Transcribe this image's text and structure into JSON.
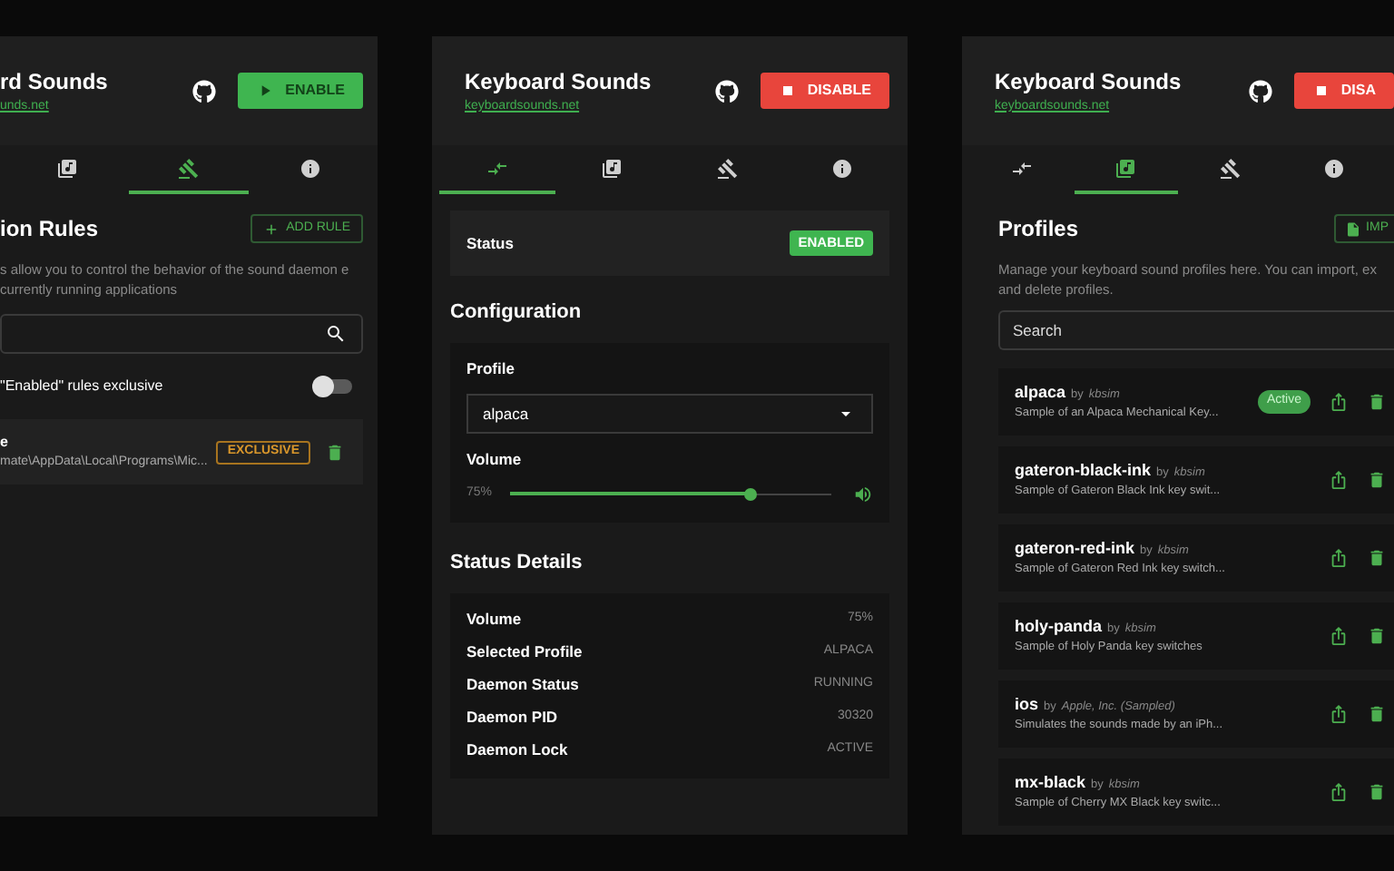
{
  "rules_panel": {
    "title": "rd Sounds",
    "link": "unds.net",
    "button": {
      "kind": "enable",
      "label": "ENABLE"
    },
    "tabs": [
      {
        "kind": "profiles",
        "selected": false
      },
      {
        "kind": "rules",
        "selected": true
      },
      {
        "kind": "about",
        "selected": false
      }
    ],
    "heading": "ion Rules",
    "add_button": "ADD RULE",
    "description": "s allow you to control the behavior of the sound daemon e currently running applications",
    "toggle": {
      "label": "\"Enabled\" rules exclusive",
      "on": false
    },
    "rules": [
      {
        "name": "e",
        "path": "mate\\AppData\\Local\\Programs\\Mic...",
        "badge": "EXCLUSIVE"
      }
    ]
  },
  "status_panel": {
    "title": "Keyboard Sounds",
    "link": "keyboardsounds.net",
    "button": {
      "kind": "disable",
      "label": "DISABLE"
    },
    "tabs": [
      {
        "kind": "status",
        "selected": true
      },
      {
        "kind": "profiles",
        "selected": false
      },
      {
        "kind": "rules",
        "selected": false
      },
      {
        "kind": "about",
        "selected": false
      }
    ],
    "status": {
      "label": "Status",
      "badge": "ENABLED"
    },
    "configuration": {
      "heading": "Configuration",
      "profile_label": "Profile",
      "profile_value": "alpaca",
      "volume_label": "Volume",
      "volume_reading": "75%",
      "level": 0.75
    },
    "details": {
      "heading": "Status Details",
      "rows": [
        {
          "label": "Volume",
          "value": "75%"
        },
        {
          "label": "Selected Profile",
          "value": "ALPACA"
        },
        {
          "label": "Daemon Status",
          "value": "RUNNING"
        },
        {
          "label": "Daemon PID",
          "value": "30320"
        },
        {
          "label": "Daemon Lock",
          "value": "ACTIVE"
        }
      ]
    }
  },
  "profiles_panel": {
    "title": "Keyboard Sounds",
    "link": "keyboardsounds.net",
    "button": {
      "kind": "disable",
      "label": "DISA"
    },
    "tabs": [
      {
        "kind": "status",
        "selected": false
      },
      {
        "kind": "profiles",
        "selected": true
      },
      {
        "kind": "rules",
        "selected": false
      },
      {
        "kind": "about",
        "selected": false
      }
    ],
    "heading": "Profiles",
    "import_button": "IMP",
    "description": "Manage your keyboard sound profiles here. You can import, ex and delete profiles.",
    "search": {
      "placeholder": "Search"
    },
    "profiles": [
      {
        "name": "alpaca",
        "by": "by",
        "author": "kbsim",
        "description": "Sample of an Alpaca Mechanical Key...",
        "badge": "Active"
      },
      {
        "name": "gateron-black-ink",
        "by": "by",
        "author": "kbsim",
        "description": "Sample of Gateron Black Ink key swit..."
      },
      {
        "name": "gateron-red-ink",
        "by": "by",
        "author": "kbsim",
        "description": "Sample of Gateron Red Ink key switch..."
      },
      {
        "name": "holy-panda",
        "by": "by",
        "author": "kbsim",
        "description": "Sample of Holy Panda key switches"
      },
      {
        "name": "ios",
        "by": "by",
        "author": "Apple, Inc. (Sampled)",
        "description": "Simulates the sounds made by an iPh..."
      },
      {
        "name": "mx-black",
        "by": "by",
        "author": "kbsim",
        "description": "Sample of Cherry MX Black key switc..."
      }
    ]
  }
}
